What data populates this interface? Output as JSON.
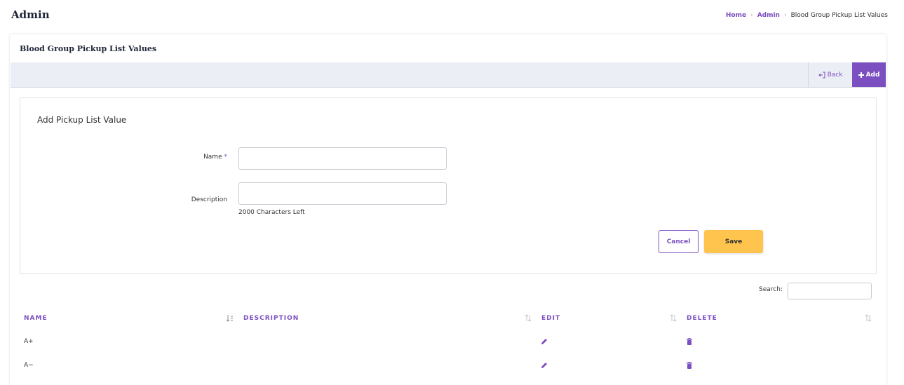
{
  "header": {
    "title": "Admin",
    "breadcrumb": {
      "home": "Home",
      "admin": "Admin",
      "current": "Blood Group Pickup List Values",
      "separator": "›"
    }
  },
  "card": {
    "title": "Blood Group Pickup List Values",
    "toolbar": {
      "back_label": "Back",
      "add_label": "Add"
    }
  },
  "form": {
    "title": "Add Pickup List Value",
    "name_label": "Name",
    "required_mark": "*",
    "name_value": "",
    "description_label": "Description",
    "description_value": "",
    "chars_left": "2000 Characters Left",
    "cancel_label": "Cancel",
    "save_label": "Save"
  },
  "table": {
    "search_label": "Search:",
    "search_value": "",
    "columns": [
      "NAME",
      "DESCRIPTION",
      "EDIT",
      "DELETE"
    ],
    "rows": [
      {
        "name": "A+",
        "description": ""
      },
      {
        "name": "A−",
        "description": ""
      }
    ]
  },
  "colors": {
    "accent": "#7b4fc0",
    "save": "#ffc44d",
    "toolbar_bg": "#eceef6"
  },
  "icons": {
    "back": "back-arrow-icon",
    "add": "plus-icon",
    "edit": "pencil-icon",
    "delete": "trash-icon",
    "sort": "sort-icon"
  }
}
